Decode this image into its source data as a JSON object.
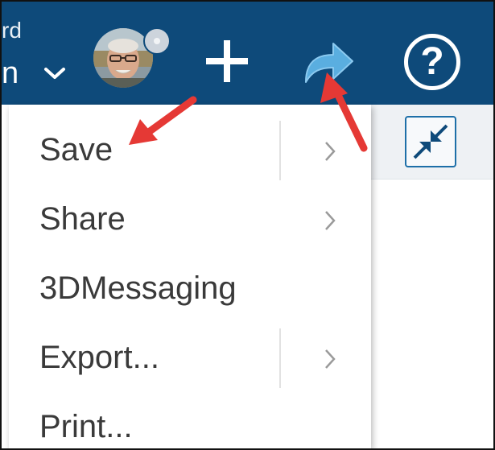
{
  "header": {
    "text_fragment_top": "rd",
    "text_fragment_name": "n",
    "caret_icon": "chevron-down-icon",
    "avatar_icon": "user-avatar",
    "status_badge_icon": "status-dot-icon",
    "add_icon": "plus-icon",
    "share_icon": "share-arrow-icon",
    "help_label": "?",
    "background_color": "#0e4a7a"
  },
  "menu": {
    "items": [
      {
        "label": "Save",
        "has_submenu": true
      },
      {
        "label": "Share",
        "has_submenu": true
      },
      {
        "label": "3DMessaging",
        "has_submenu": false
      },
      {
        "label": "Export...",
        "has_submenu": true
      },
      {
        "label": "Print...",
        "has_submenu": false
      }
    ]
  },
  "side_panel": {
    "collapse_icon": "collapse-arrows-icon"
  },
  "annotations": {
    "arrow_color": "#e53935"
  }
}
